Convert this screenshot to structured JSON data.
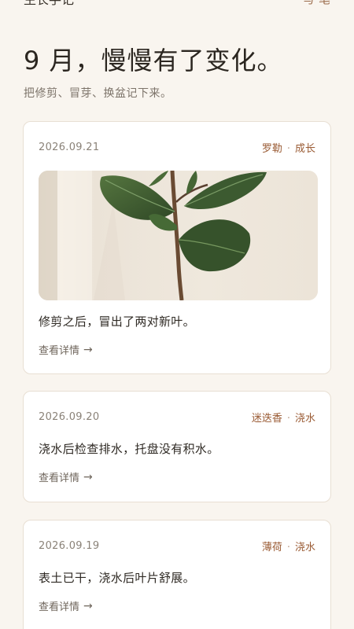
{
  "header": {
    "title": "生长手记",
    "right_label": "写 笔"
  },
  "hero": {
    "title": "9 月，慢慢有了变化。",
    "subtitle": "把修剪、冒芽、换盆记下来。"
  },
  "entries": [
    {
      "date": "2026.09.21",
      "plant": "罗勒",
      "separator": "·",
      "category": "成长",
      "text": "修剪之后，冒出了两对新叶。",
      "link": "查看详情",
      "has_photo": true
    },
    {
      "date": "2026.09.20",
      "plant": "迷迭香",
      "separator": "·",
      "category": "浇水",
      "text": "浇水后检查排水，托盘没有积水。",
      "link": "查看详情",
      "has_photo": false
    },
    {
      "date": "2026.09.19",
      "plant": "薄荷",
      "separator": "·",
      "category": "浇水",
      "text": "表土已干，浇水后叶片舒展。",
      "link": "查看详情",
      "has_photo": false
    }
  ],
  "colors": {
    "background": "#f9f5ef",
    "card": "#ffffff",
    "accent": "#9a5b34",
    "leaf": "#3f5a32"
  }
}
